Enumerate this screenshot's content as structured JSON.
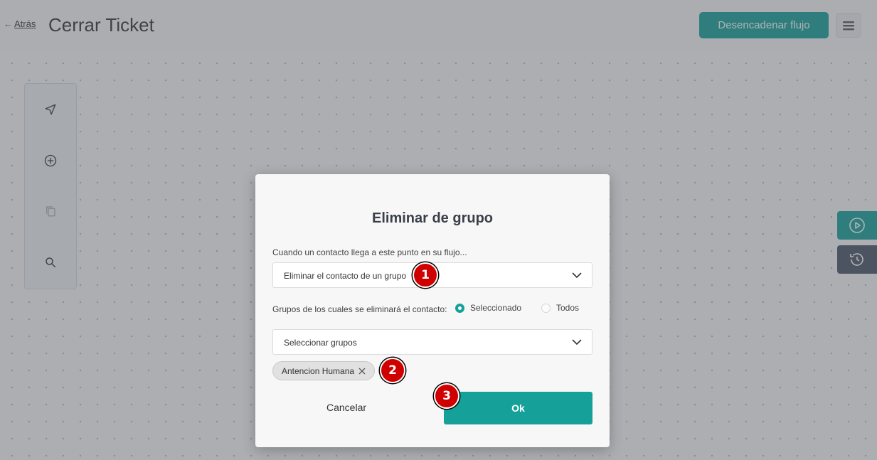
{
  "header": {
    "back_arrow": "←",
    "back_label": "Atrás",
    "title": "Cerrar Ticket",
    "trigger_button": "Desencadenar flujo",
    "menu_icon": "hamburger-icon"
  },
  "toolbar": {
    "tools": [
      {
        "icon": "navigate-icon"
      },
      {
        "icon": "add-circle-icon"
      },
      {
        "icon": "copy-icon"
      },
      {
        "icon": "search-icon"
      }
    ]
  },
  "side": {
    "play_icon": "play-icon",
    "history_icon": "history-icon"
  },
  "modal": {
    "title": "Eliminar de grupo",
    "when_label": "Cuando un contacto llega a este punto en su flujo...",
    "action_value": "Eliminar el contacto de un grupo",
    "groups_label": "Grupos de los cuales se eliminará el contacto:",
    "radio_selected": "Seleccionado",
    "radio_all": "Todos",
    "groups_placeholder": "Seleccionar grupos",
    "chip_label": "Antencion Humana",
    "cancel_label": "Cancelar",
    "ok_label": "Ok"
  },
  "annotations": [
    "1",
    "2",
    "3"
  ],
  "colors": {
    "accent": "#15a199",
    "history_button": "#4b5567",
    "badge": "#d10000"
  }
}
